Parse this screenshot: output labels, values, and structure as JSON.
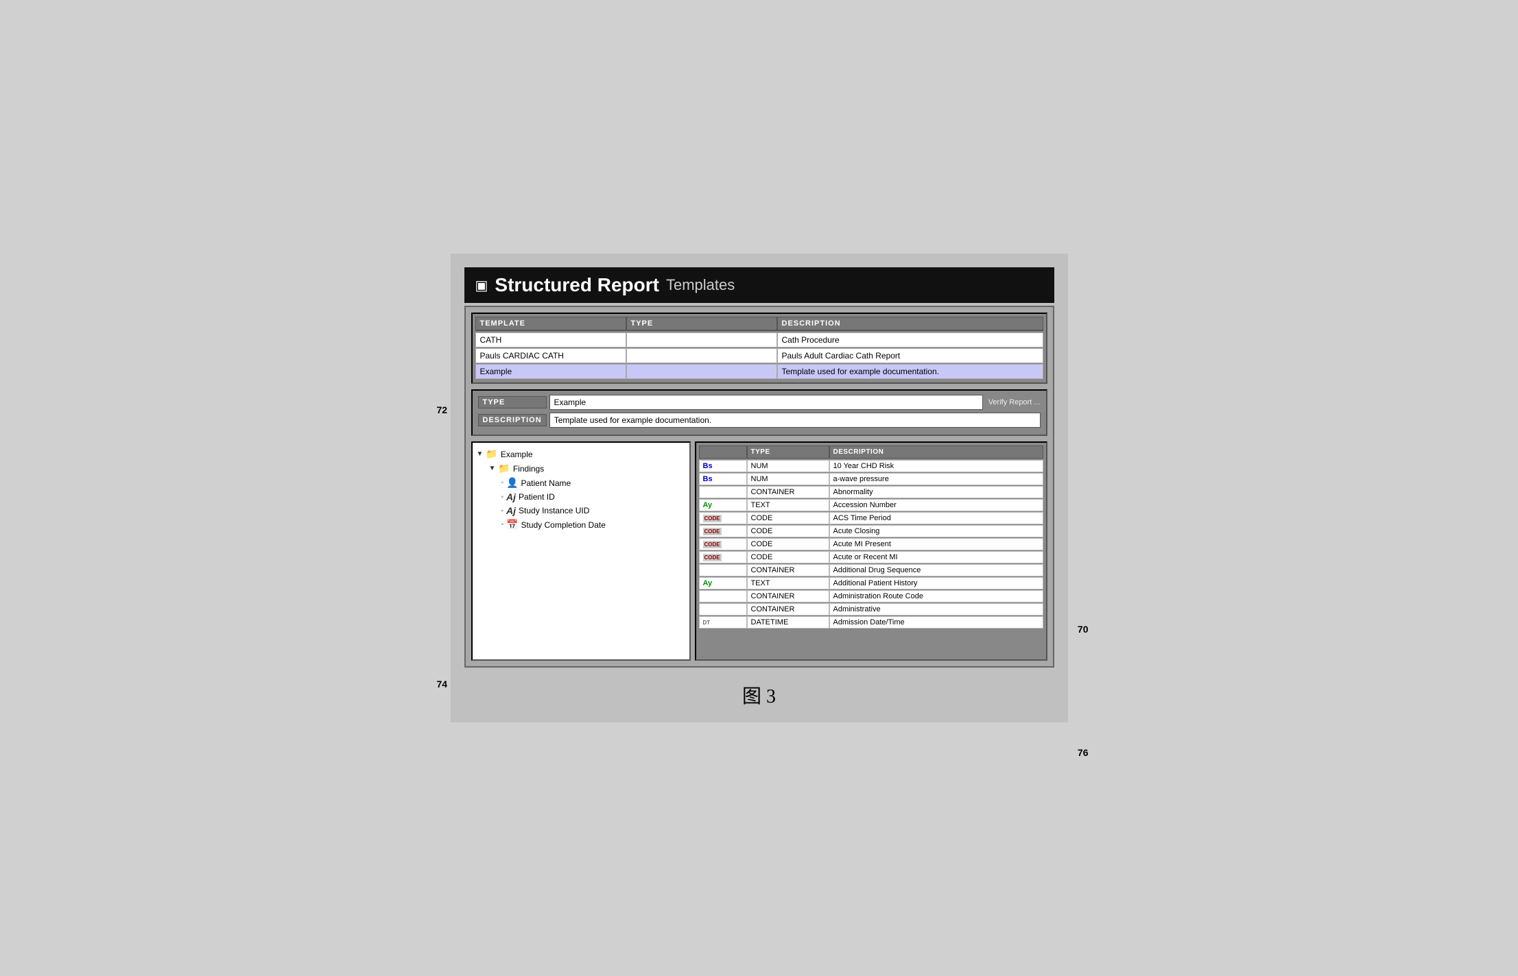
{
  "title": {
    "icon": "▣",
    "main": "Structured Report",
    "sub": "Templates"
  },
  "templateList": {
    "headers": [
      "TEMPLATE",
      "TYPE",
      "DESCRIPTION"
    ],
    "rows": [
      {
        "template": "CATH",
        "type": "",
        "description": "Cath Procedure",
        "selected": false
      },
      {
        "template": "Pauls CARDIAC CATH",
        "type": "",
        "description": "Pauls Adult Cardiac Cath Report",
        "selected": false
      },
      {
        "template": "Example",
        "type": "",
        "description": "Template used for example documentation.",
        "selected": true
      }
    ]
  },
  "detailFields": {
    "typeLabel": "TYPE",
    "typeValue": "Example",
    "typeExtra": "Verify Report ...",
    "descLabel": "DESCRIPTION",
    "descValue": "Template used for example documentation."
  },
  "tree": {
    "label": "Example",
    "children": [
      {
        "label": "Findings",
        "children": [
          {
            "label": "Patient Name",
            "icon": "👤"
          },
          {
            "label": "Patient ID",
            "icon": "A"
          },
          {
            "label": "Study Instance UID",
            "icon": "A"
          },
          {
            "label": "Study Completion Date",
            "icon": "📅"
          }
        ]
      }
    ]
  },
  "catalog": {
    "headers": [
      "",
      "TYPE",
      "DESCRIPTION"
    ],
    "rows": [
      {
        "icon": "Bs",
        "iconClass": "type-num",
        "type": "NUM",
        "description": "10 Year CHD Risk"
      },
      {
        "icon": "Bs",
        "iconClass": "type-num",
        "type": "NUM",
        "description": "a-wave pressure"
      },
      {
        "icon": "",
        "iconClass": "type-container",
        "type": "CONTAINER",
        "description": "Abnormality"
      },
      {
        "icon": "Ay",
        "iconClass": "type-text",
        "type": "TEXT",
        "description": "Accession Number"
      },
      {
        "icon": "CODE",
        "iconClass": "type-code",
        "type": "CODE",
        "description": "ACS Time Period"
      },
      {
        "icon": "CODE",
        "iconClass": "type-code",
        "type": "CODE",
        "description": "Acute Closing"
      },
      {
        "icon": "CODE",
        "iconClass": "type-code",
        "type": "CODE",
        "description": "Acute MI Present"
      },
      {
        "icon": "CODE",
        "iconClass": "type-code",
        "type": "CODE",
        "description": "Acute or Recent MI"
      },
      {
        "icon": "",
        "iconClass": "type-container",
        "type": "CONTAINER",
        "description": "Additional Drug Sequence"
      },
      {
        "icon": "Ay",
        "iconClass": "type-text",
        "type": "TEXT",
        "description": "Additional Patient History"
      },
      {
        "icon": "",
        "iconClass": "type-container",
        "type": "CONTAINER",
        "description": "Administration Route Code"
      },
      {
        "icon": "",
        "iconClass": "type-container",
        "type": "CONTAINER",
        "description": "Administrative"
      },
      {
        "icon": "DT",
        "iconClass": "type-datetime",
        "type": "DATETIME",
        "description": "Admission Date/Time"
      }
    ]
  },
  "refLabels": {
    "r70": "70",
    "r72": "72",
    "r74": "74",
    "r76": "76"
  },
  "figureCaption": "图 3"
}
